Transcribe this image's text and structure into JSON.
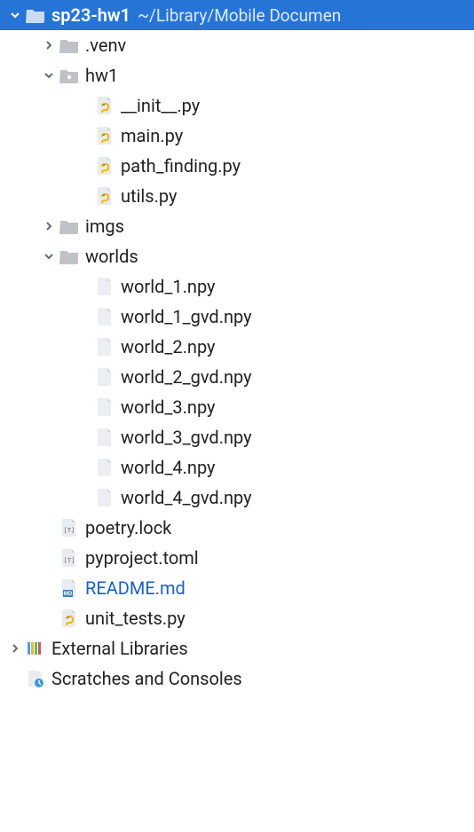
{
  "project": {
    "name": "sp23-hw1",
    "pathHint": "~/Library/Mobile Documen"
  },
  "tree": {
    "venv": ".venv",
    "hw1": {
      "name": "hw1",
      "files": {
        "init": "__init__.py",
        "main": "main.py",
        "path_finding": "path_finding.py",
        "utils": "utils.py"
      }
    },
    "imgs": "imgs",
    "worlds": {
      "name": "worlds",
      "files": {
        "w1": "world_1.npy",
        "w1g": "world_1_gvd.npy",
        "w2": "world_2.npy",
        "w2g": "world_2_gvd.npy",
        "w3": "world_3.npy",
        "w3g": "world_3_gvd.npy",
        "w4": "world_4.npy",
        "w4g": "world_4_gvd.npy"
      }
    },
    "poetry_lock": "poetry.lock",
    "pyproject": "pyproject.toml",
    "readme": "README.md",
    "unit_tests": "unit_tests.py"
  },
  "roots": {
    "external": "External Libraries",
    "scratches": "Scratches and Consoles"
  }
}
